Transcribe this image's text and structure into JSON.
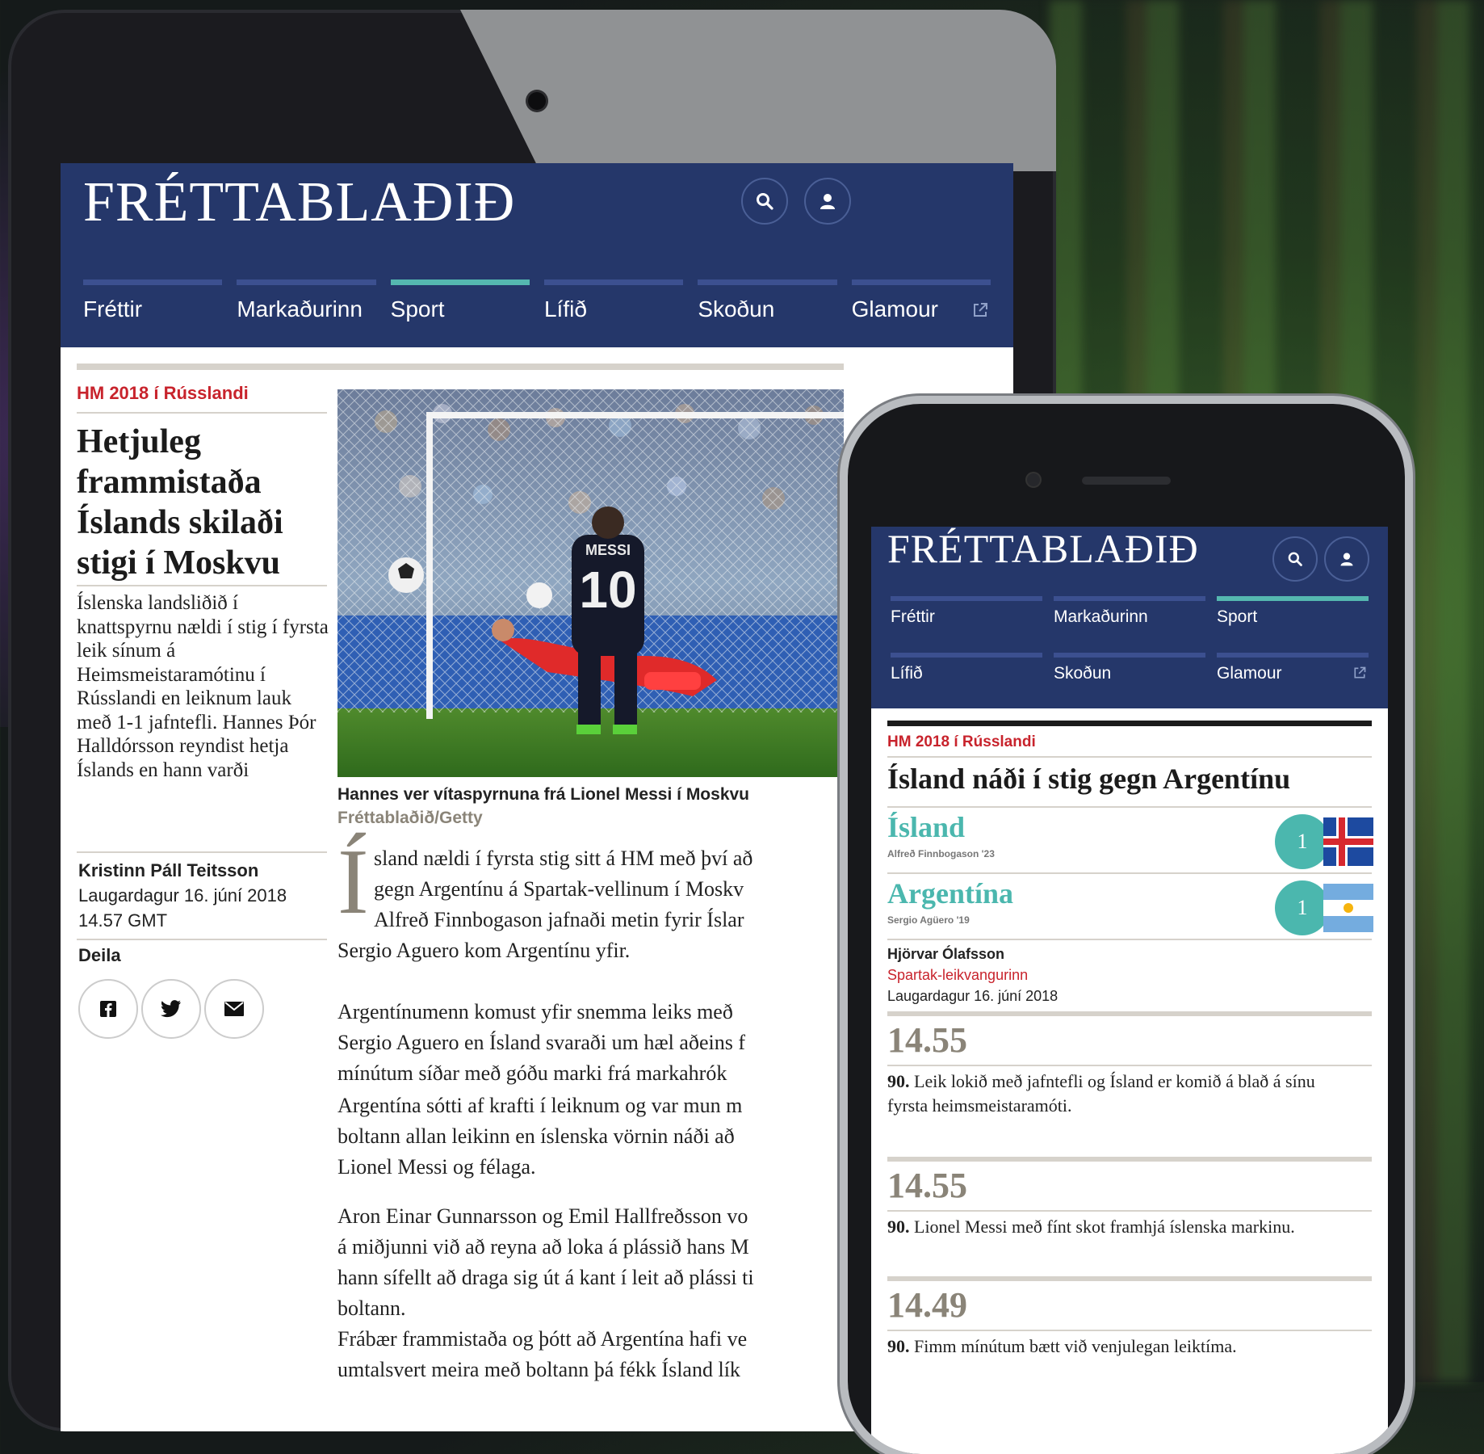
{
  "brand": {
    "logo_text": "FRÉTTABLAÐIÐ"
  },
  "colors": {
    "navy": "#25376a",
    "nav_bar": "#3c5090",
    "teal": "#55b8b0",
    "red": "#c8232c",
    "gray_rule": "#d6d2cb"
  },
  "icons": {
    "search": "search-icon",
    "user": "user-icon",
    "external": "external-link-icon"
  },
  "tablet": {
    "nav": [
      {
        "label": "Fréttir",
        "active": false
      },
      {
        "label": "Markaðurinn",
        "active": false
      },
      {
        "label": "Sport",
        "active": true
      },
      {
        "label": "Lífið",
        "active": false
      },
      {
        "label": "Skoðun",
        "active": false
      },
      {
        "label": "Glamour",
        "active": false
      }
    ],
    "article": {
      "kicker": "HM 2018 í Rússlandi",
      "headline_lines": [
        "Hetjuleg",
        "frammistaða",
        "Íslands skilaði",
        "stigi í Moskvu"
      ],
      "lead_lines": [
        "Íslenska landsliðið í",
        "knattspyrnu nældi í stig í fyrsta",
        "leik sínum á",
        "Heimsmeistaramótinu í",
        "Rússlandi en leiknum lauk",
        "með 1-1 jafntefli. Hannes Þór",
        "Halldórsson reyndist hetja",
        "Íslands en hann varði"
      ],
      "author": "Kristinn Páll Teitsson",
      "date": "Laugardagur 16. júní 2018",
      "time": "14.57 GMT",
      "share_label": "Deila",
      "photo_caption": "Hannes ver vítaspyrnuna frá Lionel Messi í Moskvu",
      "photo_credit": "Fréttablaðið/Getty",
      "jersey_name": "MESSI",
      "jersey_number": "10",
      "drop_cap": "Í",
      "para1_lines": [
        "sland nældi í fyrsta stig sitt á HM með því að",
        "gegn Argentínu á Spartak-vellinum í Moskv",
        "Alfreð Finnbogason jafnaði metin fyrir Íslar",
        "Sergio Aguero kom Argentínu yfir."
      ],
      "para2_lines": [
        "Argentínumenn komust yfir snemma leiks með",
        "Sergio Aguero en Ísland svaraði um hæl aðeins f",
        "mínútum síðar með góðu marki frá markahrók"
      ],
      "para3_lines": [
        "Argentína sótti af krafti í leiknum og var mun m",
        "boltann allan leikinn en íslenska vörnin náði að",
        "Lionel Messi og félaga."
      ],
      "para4_lines": [
        "Aron Einar Gunnarsson og Emil Hallfreðsson vo",
        "á miðjunni við að reyna að loka á plássið hans M",
        "hann sífellt að draga sig út á kant í leit að plássi ti",
        "boltann."
      ],
      "para5_lines": [
        "Frábær frammistaða og þótt að Argentína hafi ve",
        "umtalsvert meira með boltann þá fékk Ísland lík"
      ]
    }
  },
  "phone": {
    "nav_row1": [
      {
        "label": "Fréttir",
        "active": false
      },
      {
        "label": "Markaðurinn",
        "active": false
      },
      {
        "label": "Sport",
        "active": true
      }
    ],
    "nav_row2": [
      {
        "label": "Lífið",
        "active": false
      },
      {
        "label": "Skoðun",
        "active": false
      },
      {
        "label": "Glamour",
        "active": false
      }
    ],
    "kicker": "HM 2018 í Rússlandi",
    "headline": "Ísland náði í stig gegn Argentínu",
    "match": {
      "home": {
        "name": "Ísland",
        "scorer": "Alfreð Finnbogason '23",
        "score": "1"
      },
      "away": {
        "name": "Argentína",
        "scorer": "Sergio Agüero '19",
        "score": "1"
      }
    },
    "author": "Hjörvar Ólafsson",
    "venue": "Spartak-leikvangurinn",
    "date": "Laugardagur 16. júní 2018",
    "live": [
      {
        "time": "14.55",
        "minute": "90.",
        "lines": [
          "Leik lokið með jafntefli og Ísland er komið á blað á sínu",
          "fyrsta heimsmeistaramóti."
        ]
      },
      {
        "time": "14.55",
        "minute": "90.",
        "lines": [
          "Lionel Messi með fínt skot framhjá íslenska markinu."
        ]
      },
      {
        "time": "14.49",
        "minute": "90.",
        "lines": [
          "Fimm mínútum bætt við venjulegan leiktíma."
        ]
      }
    ]
  }
}
